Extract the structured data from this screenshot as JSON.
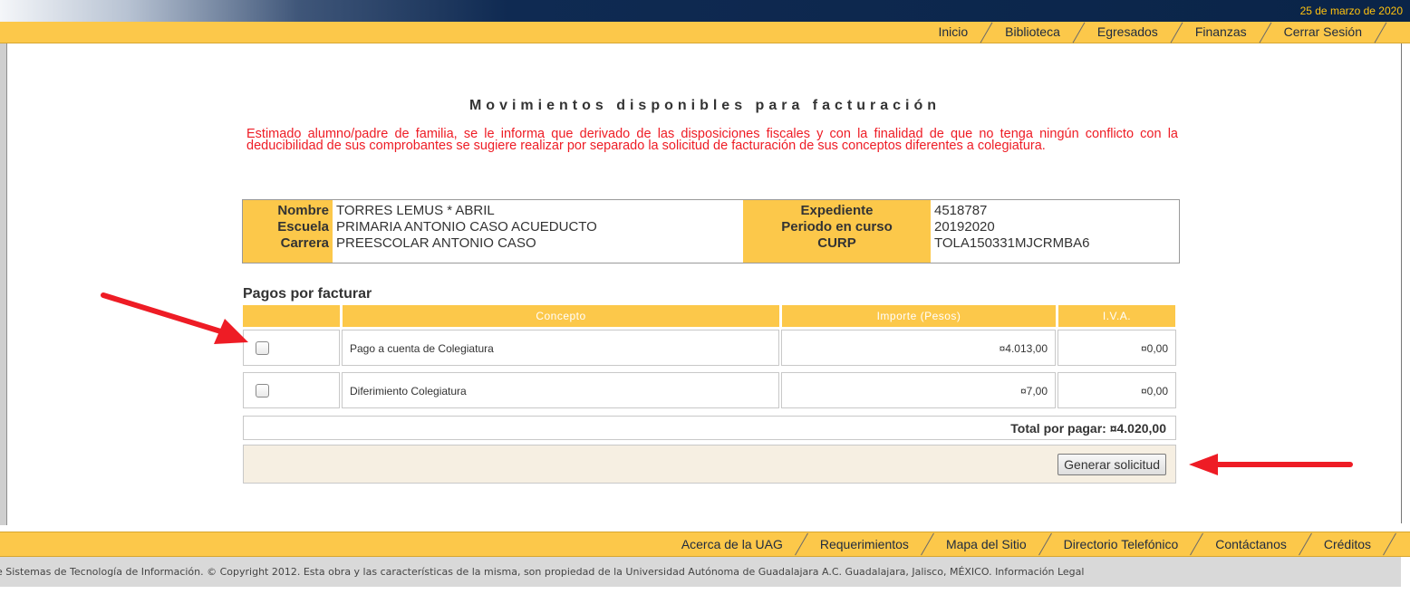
{
  "header": {
    "date": "25 de marzo de 2020",
    "nav": [
      "Inicio",
      "Biblioteca",
      "Egresados",
      "Finanzas",
      "Cerrar Sesión"
    ]
  },
  "main": {
    "title": "Movimientos disponibles para facturación",
    "notice": "Estimado alumno/padre de familia, se le informa que derivado de las disposiciones fiscales y con la finalidad de que no tenga ningún conflicto con la deducibilidad de sus comprobantes se sugiere realizar por separado la solicitud de facturación de sus conceptos diferentes a colegiatura.",
    "student": {
      "nombre_label": "Nombre",
      "nombre": "TORRES LEMUS * ABRIL",
      "escuela_label": "Escuela",
      "escuela": "PRIMARIA ANTONIO CASO ACUEDUCTO",
      "carrera_label": "Carrera",
      "carrera": "PREESCOLAR ANTONIO CASO",
      "expediente_label": "Expediente",
      "expediente": "4518787",
      "periodo_label": "Periodo en curso",
      "periodo": "20192020",
      "curp_label": "CURP",
      "curp": "TOLA150331MJCRMBA6"
    },
    "payments": {
      "title": "Pagos por facturar",
      "columns": [
        "Concepto",
        "Importe (Pesos)",
        "I.V.A."
      ],
      "rows": [
        {
          "concepto": "Pago a cuenta de Colegiatura",
          "importe": "¤4.013,00",
          "iva": "¤0,00",
          "checked": false
        },
        {
          "concepto": "Diferimiento Colegiatura",
          "importe": "¤7,00",
          "iva": "¤0,00",
          "checked": false
        }
      ],
      "total": "Total por pagar: ¤4.020,00",
      "button": "Generar solicitud"
    }
  },
  "footer": {
    "nav": [
      "Acerca de la UAG",
      "Requerimientos",
      "Mapa del Sitio",
      "Directorio Telefónico",
      "Contáctanos",
      "Créditos"
    ],
    "copyright": "e Sistemas de Tecnología de Información. © Copyright 2012. Esta obra y las características de la misma, son propiedad de la Universidad Autónoma de Guadalajara A.C. Guadalajara, Jalisco, MÉXICO. Información Legal"
  },
  "colors": {
    "accent": "#fcc84a",
    "header_dark": "#0a2448",
    "notice": "#ee1c25",
    "arrow": "#ee1c25"
  }
}
